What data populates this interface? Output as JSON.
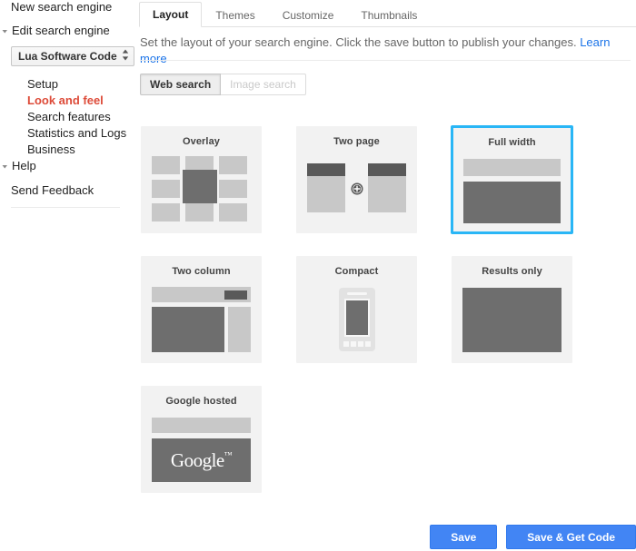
{
  "sidebar": {
    "new_engine_label": "New search engine",
    "edit_engine_label": "Edit search engine",
    "help_label": "Help",
    "feedback_label": "Send Feedback",
    "engine_select_value": "Lua Software Code",
    "sub_items": [
      {
        "label": "Setup",
        "active": false
      },
      {
        "label": "Look and feel",
        "active": true
      },
      {
        "label": "Search features",
        "active": false
      },
      {
        "label": "Statistics and Logs",
        "active": false
      },
      {
        "label": "Business",
        "active": false
      }
    ],
    "active_color": "#dd4b39"
  },
  "main": {
    "tabs": [
      {
        "label": "Layout",
        "active": true
      },
      {
        "label": "Themes",
        "active": false
      },
      {
        "label": "Customize",
        "active": false
      },
      {
        "label": "Thumbnails",
        "active": false
      }
    ],
    "description": "Set the layout of your search engine. Click the save button to publish your changes.",
    "learn_more_label": "Learn more",
    "link_color": "#1a73e8",
    "search_types": [
      {
        "label": "Web search",
        "active": true,
        "disabled": false
      },
      {
        "label": "Image search",
        "active": false,
        "disabled": true
      }
    ],
    "selected_layout": "Full width",
    "selection_color": "#29b6f6",
    "layouts": [
      {
        "id": "overlay",
        "title": "Overlay",
        "selected": false
      },
      {
        "id": "two-page",
        "title": "Two page",
        "selected": false
      },
      {
        "id": "full-width",
        "title": "Full width",
        "selected": true
      },
      {
        "id": "two-column",
        "title": "Two column",
        "selected": false
      },
      {
        "id": "compact",
        "title": "Compact",
        "selected": false
      },
      {
        "id": "results-only",
        "title": "Results only",
        "selected": false
      },
      {
        "id": "google-hosted",
        "title": "Google hosted",
        "selected": false
      }
    ],
    "google_logo_text": "Google",
    "google_logo_tm": "™"
  },
  "footer": {
    "save_label": "Save",
    "save_get_code_label": "Save & Get Code",
    "button_color": "#4285f4"
  }
}
